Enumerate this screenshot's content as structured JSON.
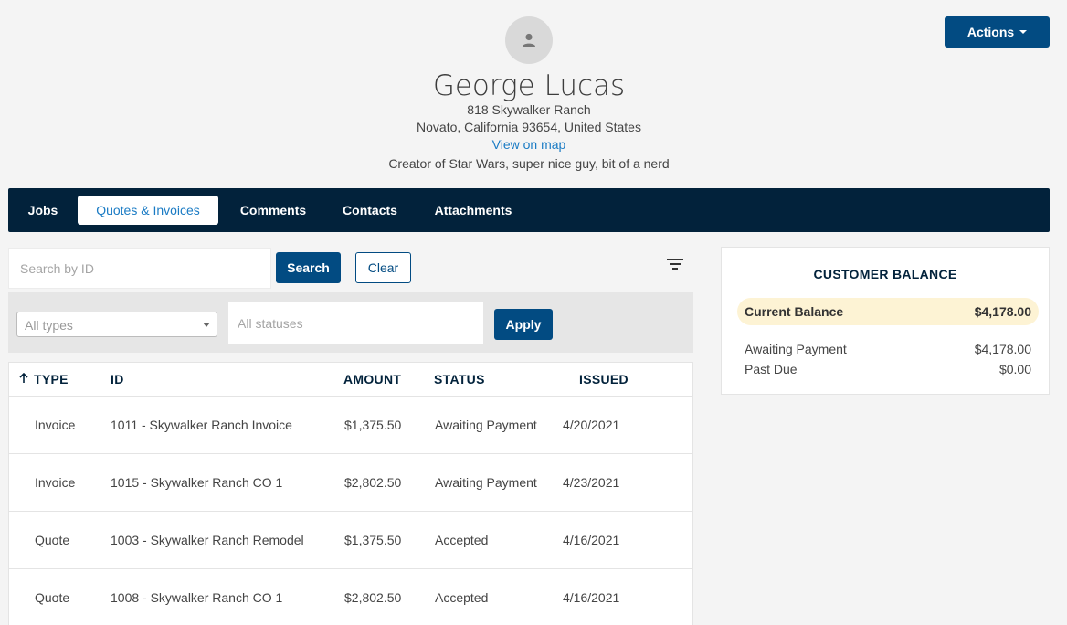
{
  "customer": {
    "name": "George Lucas",
    "address_line1": "818 Skywalker Ranch",
    "address_line2": "Novato, California 93654, United States",
    "map_link": "View on map",
    "description": "Creator of Star Wars, super nice guy, bit of a nerd"
  },
  "actions_label": "Actions",
  "tabs": [
    {
      "label": "Jobs"
    },
    {
      "label": "Quotes & Invoices"
    },
    {
      "label": "Comments"
    },
    {
      "label": "Contacts"
    },
    {
      "label": "Attachments"
    }
  ],
  "active_tab": "Quotes & Invoices",
  "search": {
    "placeholder": "Search by ID",
    "search_label": "Search",
    "clear_label": "Clear"
  },
  "filters": {
    "type_value": "All types",
    "status_placeholder": "All statuses",
    "apply_label": "Apply"
  },
  "table": {
    "columns": [
      "TYPE",
      "ID",
      "AMOUNT",
      "STATUS",
      "ISSUED"
    ],
    "sort_column": "TYPE",
    "sort_direction": "ascending",
    "rows": [
      {
        "type": "Invoice",
        "id": "1011 - Skywalker Ranch Invoice",
        "amount": "$1,375.50",
        "status": "Awaiting Payment",
        "issued": "4/20/2021"
      },
      {
        "type": "Invoice",
        "id": "1015 - Skywalker Ranch CO 1",
        "amount": "$2,802.50",
        "status": "Awaiting Payment",
        "issued": "4/23/2021"
      },
      {
        "type": "Quote",
        "id": "1003 - Skywalker Ranch Remodel",
        "amount": "$1,375.50",
        "status": "Accepted",
        "issued": "4/16/2021"
      },
      {
        "type": "Quote",
        "id": "1008 - Skywalker Ranch CO 1",
        "amount": "$2,802.50",
        "status": "Accepted",
        "issued": "4/16/2021"
      }
    ]
  },
  "balance": {
    "title": "CUSTOMER BALANCE",
    "current_label": "Current Balance",
    "current_value": "$4,178.00",
    "lines": [
      {
        "label": "Awaiting Payment",
        "value": "$4,178.00"
      },
      {
        "label": "Past Due",
        "value": "$0.00"
      }
    ]
  },
  "colors": {
    "primary": "#024b82",
    "navbar": "#02223b",
    "link": "#1a7bc4",
    "highlight": "#fdf3d4"
  },
  "icons": [
    "user-icon",
    "caret-down-icon",
    "filter-icon",
    "sort-arrow-up-icon"
  ]
}
